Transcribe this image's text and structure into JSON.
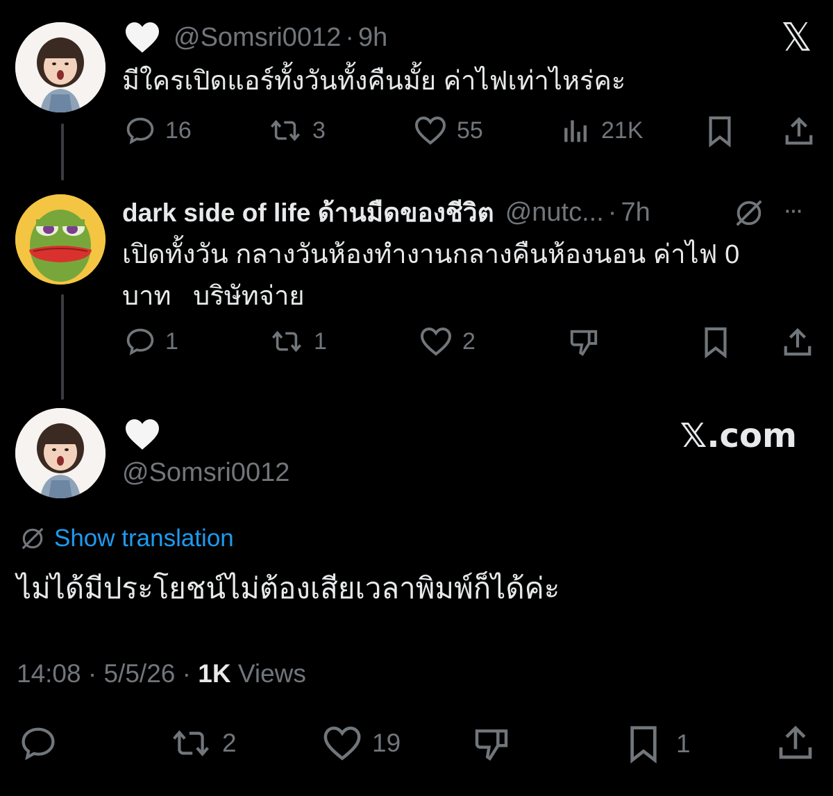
{
  "brand": {
    "x_logo": "𝕏",
    "site_label": "𝕏.com"
  },
  "tweet1": {
    "name_icon": "white-heart-icon",
    "handle": "@Somsri0012",
    "sep": "·",
    "time": "9h",
    "text": "มีใครเปิดแอร์ทั้งวันทั้งคืนมั้ย ค่าไฟเท่าไหร่คะ",
    "replies": "16",
    "reposts": "3",
    "likes": "55",
    "views": "21K"
  },
  "tweet2": {
    "name": "dark side of life ด้านมืดของชีวิต",
    "handle": "@nutc...",
    "sep": "·",
    "time": "7h",
    "more": "···",
    "text_line1": "เปิดทั้งวัน กลางวันห้องทำงานกลางคืนห้องนอน ค่าไฟ 0",
    "text_line2": "บาท   บริษัทจ่าย",
    "replies": "1",
    "reposts": "1",
    "likes": "2"
  },
  "main": {
    "handle": "@Somsri0012",
    "show_translation": "Show translation",
    "text": "ไม่ได้มีประโยชน์ไม่ต้องเสียเวลาพิมพ์ก็ได้ค่ะ",
    "time": "14:08",
    "sep1": "·",
    "date": "5/5/26",
    "sep2": "·",
    "views_count": "1K",
    "views_label": "Views",
    "reposts": "2",
    "likes": "19",
    "bookmarks": "1"
  },
  "colors": {
    "background": "#000000",
    "text": "#e7e9ea",
    "muted": "#71767b",
    "link": "#1d9bf0",
    "thread_line": "#3a3d40"
  }
}
